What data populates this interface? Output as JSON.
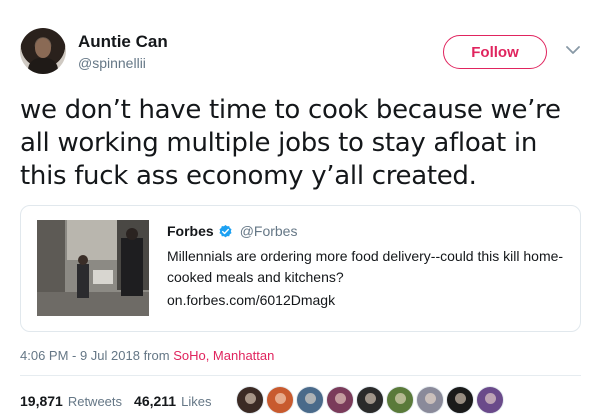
{
  "user": {
    "name": "Auntie Can",
    "handle": "@spinnellii"
  },
  "follow_label": "Follow",
  "tweet_text": "we don’t have time to cook because we’re all working multiple jobs to stay afloat in this fuck ass economy y’all created.",
  "quoted": {
    "name": "Forbes",
    "handle": "@Forbes",
    "text": "Millennials are ordering more food delivery--could this kill home-cooked meals and kitchens?",
    "link": "on.forbes.com/6012Dmagk"
  },
  "meta": {
    "time": "4:06 PM - 9 Jul 2018 from ",
    "location": "SoHo, Manhattan"
  },
  "stats": {
    "retweets_count": "19,871",
    "retweets_label": "Retweets",
    "likes_count": "46,211",
    "likes_label": "Likes"
  },
  "colors": {
    "accent": "#e0245e",
    "verified": "#1da1f2",
    "muted": "#657786"
  },
  "liker_colors": [
    "#3b2a24",
    "#c85a2e",
    "#4a6a8a",
    "#7a3b5a",
    "#2a2a2a",
    "#5a7a3a",
    "#8a8a9a",
    "#1a1a1a",
    "#6a4a8a"
  ]
}
